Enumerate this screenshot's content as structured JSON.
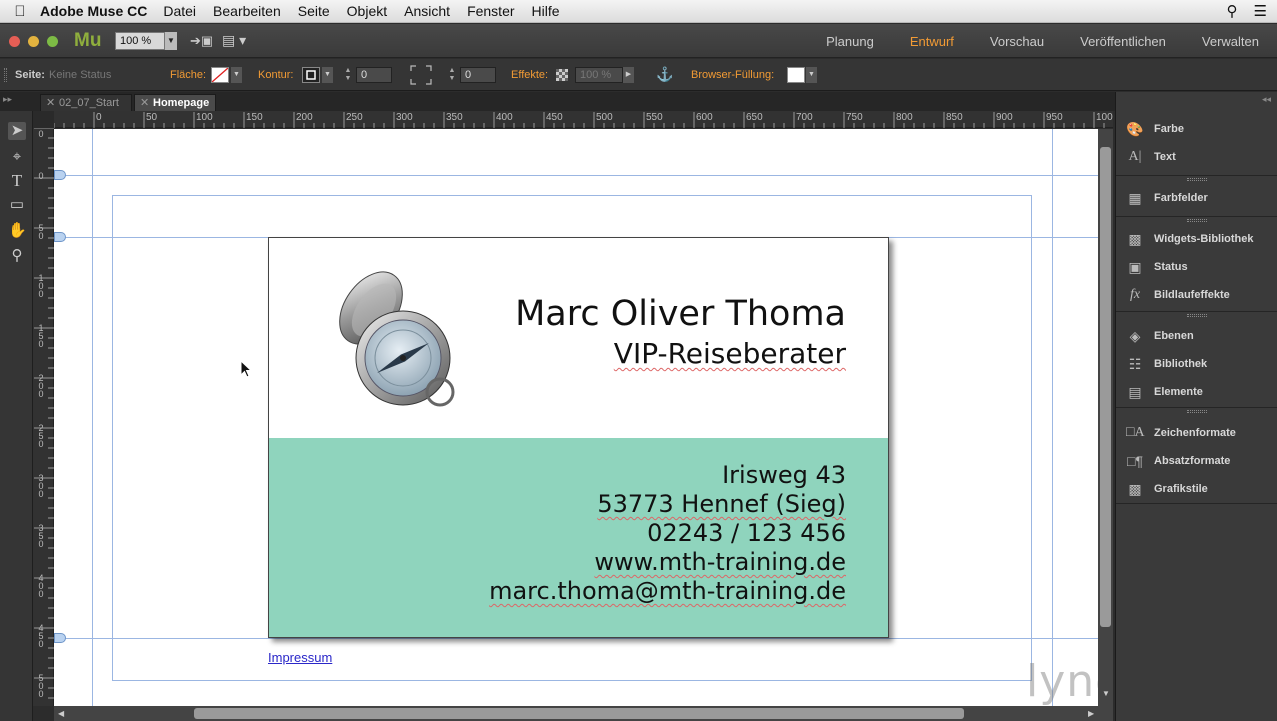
{
  "menubar": {
    "app_name": "Adobe Muse CC",
    "items": [
      "Datei",
      "Bearbeiten",
      "Seite",
      "Objekt",
      "Ansicht",
      "Fenster",
      "Hilfe"
    ]
  },
  "appbar": {
    "logo": "Mu",
    "zoom": "100 %",
    "modes": [
      "Planung",
      "Entwurf",
      "Vorschau",
      "Veröffentlichen",
      "Verwalten"
    ],
    "active_mode": "Entwurf"
  },
  "controlbar": {
    "page_label": "Seite:",
    "page_status": "Keine Status",
    "fill_label": "Fläche:",
    "stroke_label": "Kontur:",
    "stroke_value": "0",
    "corner_value": "0",
    "effects_label": "Effekte:",
    "opacity_value": "100 %",
    "browser_fill_label": "Browser-Füllung:"
  },
  "tabs": [
    {
      "label": "02_07_Start",
      "active": false
    },
    {
      "label": "Homepage",
      "active": true
    }
  ],
  "ruler": {
    "top_labels": [
      "0",
      "50",
      "100",
      "150",
      "200",
      "250",
      "300",
      "350",
      "400",
      "450",
      "500",
      "550",
      "600",
      "650",
      "700",
      "750",
      "800",
      "850",
      "900",
      "950",
      "100"
    ],
    "left_labels": [
      "0",
      "0",
      "50",
      "100",
      "150",
      "200",
      "250",
      "300",
      "350",
      "400",
      "450",
      "500"
    ]
  },
  "card": {
    "name": "Marc Oliver Thoma",
    "role": "VIP-Reiseberater",
    "street": "Irisweg 43",
    "city": "53773 Hennef (Sieg)",
    "phone": "02243 / 123 456",
    "web": "www.mth-training.de",
    "email": "marc.thoma@mth-training.de"
  },
  "footer_link": "Impressum",
  "watermark": "lynda.com",
  "panels": {
    "group1": [
      {
        "icon": "palette-icon",
        "label": "Farbe"
      },
      {
        "icon": "text-icon",
        "label": "Text"
      }
    ],
    "group2": [
      {
        "icon": "swatches-icon",
        "label": "Farbfelder"
      }
    ],
    "group3": [
      {
        "icon": "widgets-icon",
        "label": "Widgets-Bibliothek"
      },
      {
        "icon": "states-icon",
        "label": "Status"
      },
      {
        "icon": "fx-icon",
        "label": "Bildlaufeffekte"
      }
    ],
    "group4": [
      {
        "icon": "layers-icon",
        "label": "Ebenen"
      },
      {
        "icon": "library-icon",
        "label": "Bibliothek"
      },
      {
        "icon": "assets-icon",
        "label": "Elemente"
      }
    ],
    "group5": [
      {
        "icon": "char-styles-icon",
        "label": "Zeichenformate"
      },
      {
        "icon": "para-styles-icon",
        "label": "Absatzformate"
      },
      {
        "icon": "graphic-styles-icon",
        "label": "Grafikstile"
      }
    ]
  },
  "colors": {
    "accent": "#f29b35",
    "card_band": "#8fd4bd",
    "link": "#2a27c9"
  }
}
